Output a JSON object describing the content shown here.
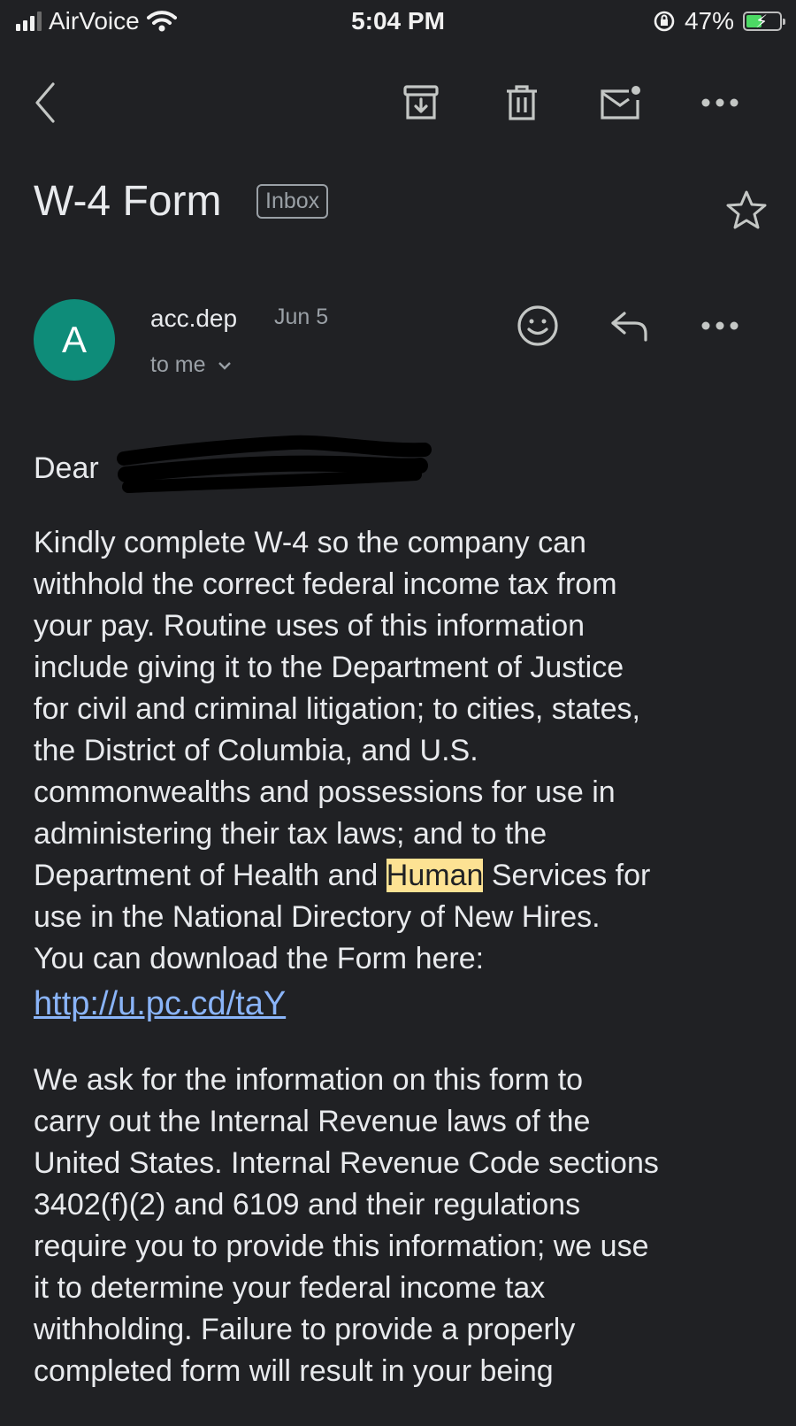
{
  "status_bar": {
    "carrier": "AirVoice",
    "time": "5:04 PM",
    "battery_percent": "47%",
    "battery_level": 0.47
  },
  "toolbar": {
    "icons": [
      "back-arrow-icon",
      "archive-icon",
      "delete-icon",
      "mark-unread-icon",
      "more-icon"
    ]
  },
  "email": {
    "subject": "W-4 Form",
    "label": "Inbox",
    "avatar_letter": "A",
    "sender": "acc.dep",
    "date": "Jun 5",
    "recipient_line": "to me",
    "greeting": "Dear",
    "paragraph1": {
      "lines": [
        "Kindly complete W-4 so the company can",
        "withhold the correct federal income tax from",
        "your pay. Routine uses of this information",
        "include giving it to the Department of Justice",
        "for civil and criminal litigation; to cities, states,",
        "the District of Columbia, and U.S.",
        "commonwealths and possessions for use in",
        "administering their tax laws; and to the"
      ],
      "highlight_line_before": "Department of Health and ",
      "highlight_word": "Human",
      "highlight_line_after": " Services for",
      "lines_after": [
        "use in the National Directory of New Hires.",
        "You can download the Form here:"
      ],
      "link": "http://u.pc.cd/taY"
    },
    "paragraph2": {
      "lines": [
        "We ask for the information on this form to",
        "carry out the Internal Revenue laws of the",
        "United States. Internal Revenue Code sections",
        "3402(f)(2) and 6109 and their regulations",
        "require you to provide this information; we use",
        "it to determine your federal income tax",
        "withholding. Failure to provide a properly",
        "completed form will result in your being"
      ]
    }
  }
}
